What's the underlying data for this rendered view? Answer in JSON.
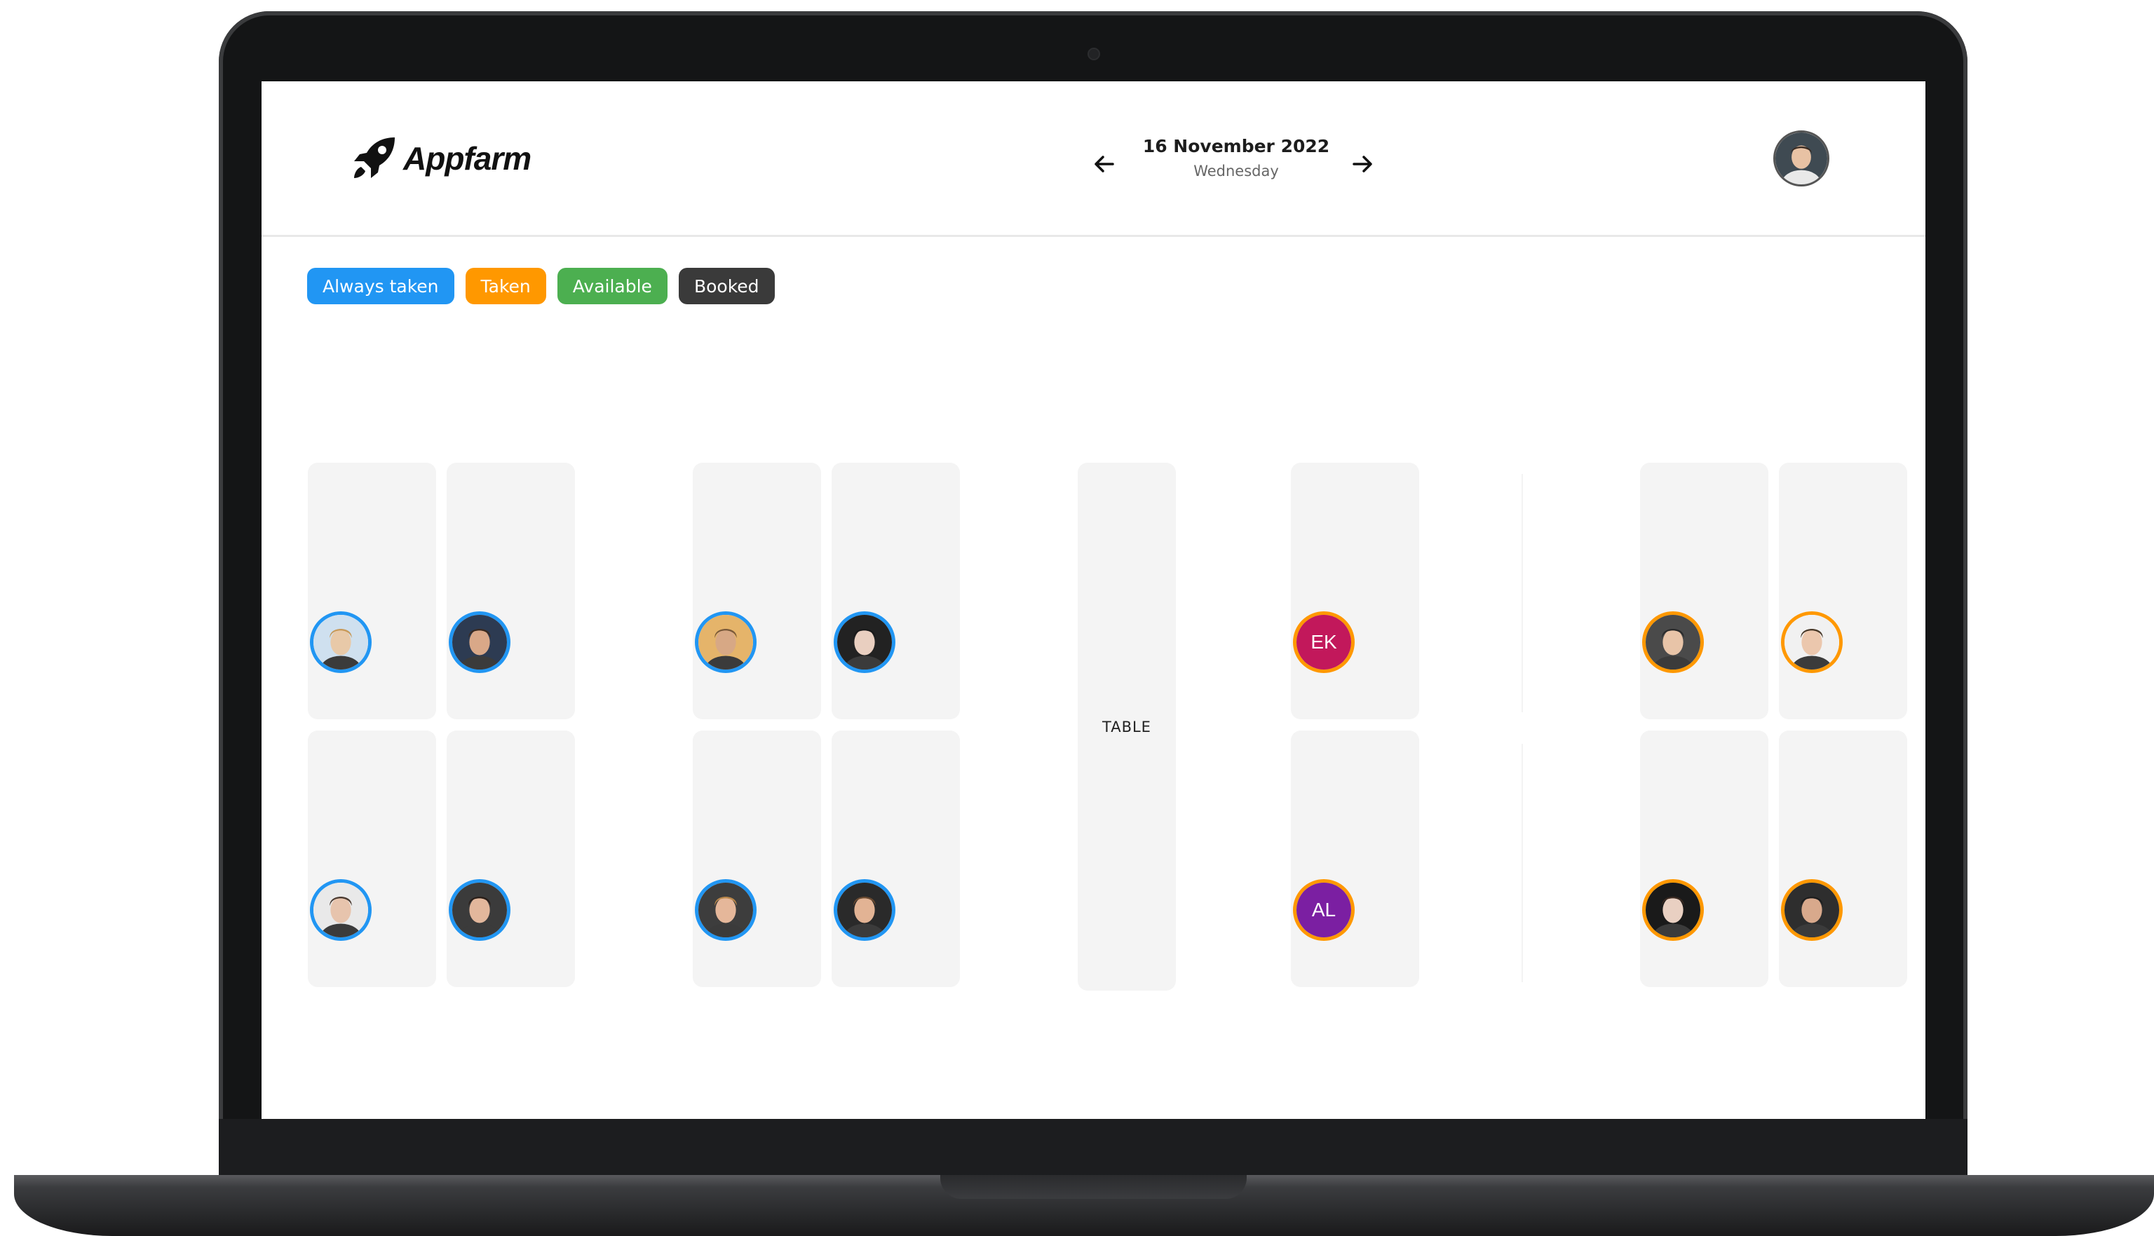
{
  "app": {
    "brand": "Appfarm"
  },
  "header": {
    "date": "16 November 2022",
    "weekday": "Wednesday",
    "prev_icon": "arrow-left-icon",
    "next_icon": "arrow-right-icon",
    "user_avatar": "user-avatar-photo"
  },
  "legend": [
    {
      "label": "Always taken",
      "color": "#2196f3"
    },
    {
      "label": "Taken",
      "color": "#ff9800"
    },
    {
      "label": "Available",
      "color": "#4caf50"
    },
    {
      "label": "Booked",
      "color": "#3a3a3a"
    }
  ],
  "floor": {
    "table_label": "TABLE",
    "seats": [
      {
        "status": "Always taken",
        "type": "photo",
        "skin": "#e8c9a8",
        "hair": "#c89a5a",
        "bg": "#cfe0ef"
      },
      {
        "status": "Always taken",
        "type": "photo",
        "skin": "#d9a888",
        "hair": "#3a2a20",
        "bg": "#2d3b52"
      },
      {
        "status": "Always taken",
        "type": "photo",
        "skin": "#e7c4ad",
        "hair": "#4a3a30",
        "bg": "#e9e9e9"
      },
      {
        "status": "Always taken",
        "type": "photo",
        "skin": "#e2b79c",
        "hair": "#2a1e18",
        "bg": "#3b3b3b"
      },
      {
        "status": "Always taken",
        "type": "photo",
        "skin": "#d7a885",
        "hair": "#7a5a3a",
        "bg": "#e5b46a"
      },
      {
        "status": "Always taken",
        "type": "photo",
        "skin": "#e9cfc0",
        "hair": "#1a1a1a",
        "bg": "#222222"
      },
      {
        "status": "Always taken",
        "type": "photo",
        "skin": "#e5b79a",
        "hair": "#b8864a",
        "bg": "#3d3d3d"
      },
      {
        "status": "Always taken",
        "type": "photo",
        "skin": "#e2b394",
        "hair": "#6a4a30",
        "bg": "#2a2a2a"
      },
      {
        "status": "Taken",
        "type": "initials",
        "initials": "EK",
        "fill": "#c2185b"
      },
      {
        "status": "Taken",
        "type": "initials",
        "initials": "AL",
        "fill": "#7b1fa2"
      },
      {
        "status": "Taken",
        "type": "photo",
        "skin": "#e8c4a8",
        "hair": "#2a2a2a",
        "bg": "#4a4a4a"
      },
      {
        "status": "Taken",
        "type": "photo",
        "skin": "#ebc7ad",
        "hair": "#4a3a2a",
        "bg": "#f1f1f1"
      },
      {
        "status": "Taken",
        "type": "photo",
        "skin": "#e9d0c2",
        "hair": "#3a2a22",
        "bg": "#1a1a1a"
      },
      {
        "status": "Taken",
        "type": "photo",
        "skin": "#d8a98c",
        "hair": "#1e1e1e",
        "bg": "#2e2e2e"
      }
    ]
  }
}
